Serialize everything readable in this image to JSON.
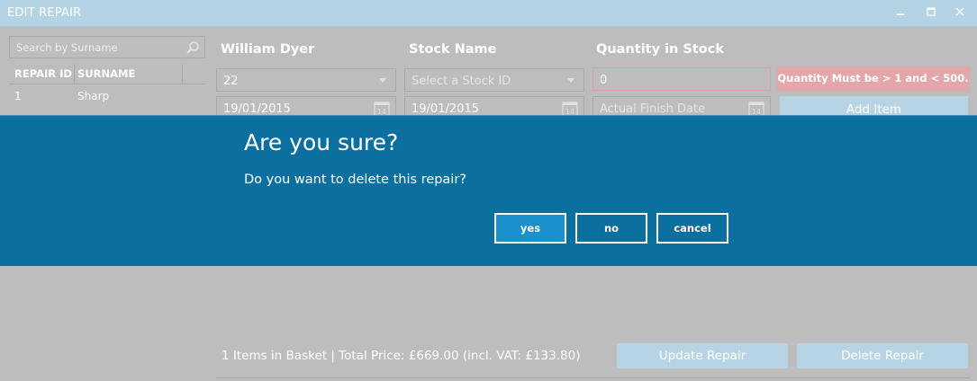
{
  "window": {
    "title": "EDIT REPAIR"
  },
  "sidebar": {
    "search_placeholder": "Search by Surname",
    "columns": [
      "REPAIR ID",
      "SURNAME"
    ],
    "rows": [
      {
        "id": "1",
        "surname": "Sharp"
      }
    ]
  },
  "form": {
    "customer_label": "William Dyer",
    "stock_label": "Stock Name",
    "quantity_label": "Quantity in Stock",
    "customer_id_value": "22",
    "stock_id_placeholder": "Select a Stock ID",
    "quantity_value": "0",
    "quantity_error": "Quantity Must be > 1 and < 500.",
    "start_date": "19/01/2015",
    "expected_date": "19/01/2015",
    "finish_date_placeholder": "Actual Finish Date",
    "add_item_label": "Add Item",
    "calendar_day": "14"
  },
  "footer": {
    "summary": "1 Items in Basket | Total Price: £669.00 (incl. VAT: £133.80)",
    "update_label": "Update Repair",
    "delete_label": "Delete Repair"
  },
  "dialog": {
    "title": "Are you sure?",
    "message": "Do you want to delete this repair?",
    "yes_label": "yes",
    "no_label": "no",
    "cancel_label": "cancel"
  },
  "colors": {
    "dialog_bg": "#0b6fa0",
    "primary_button": "#1a90cd",
    "error_bg": "#e3a7aa",
    "title_bar": "#b4d4e6"
  }
}
